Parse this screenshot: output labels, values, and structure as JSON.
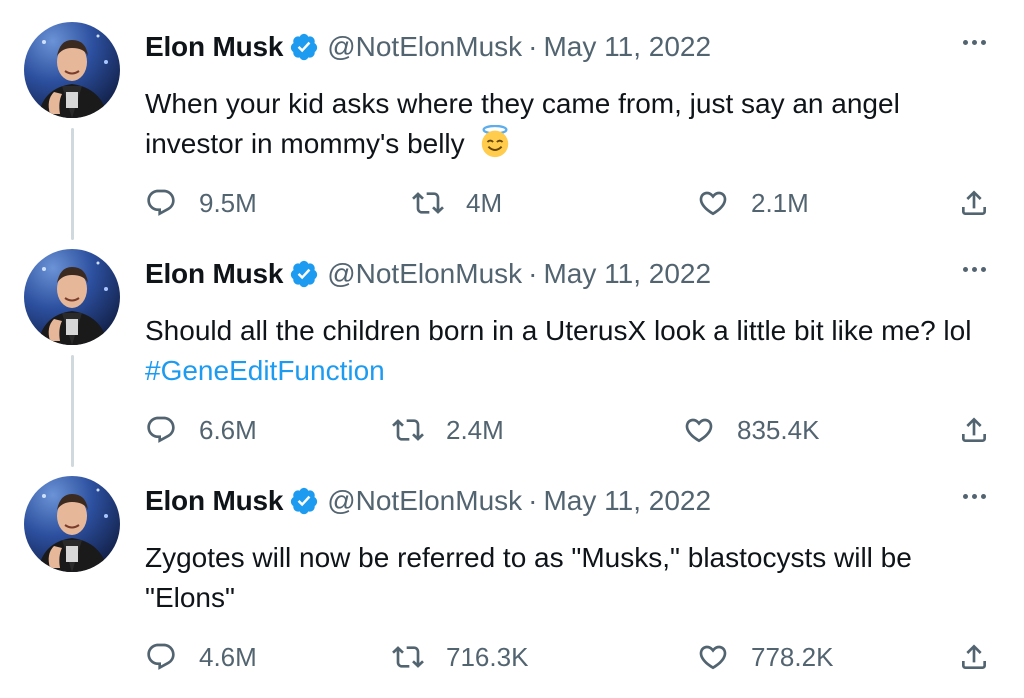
{
  "colors": {
    "text": "#0f1419",
    "muted": "#536471",
    "link": "#1d9bf0",
    "verified": "#1d9bf0",
    "thread_line": "#cfd9de"
  },
  "tweets": [
    {
      "name": "Elon Musk",
      "handle": "@NotElonMusk",
      "separator": "·",
      "date": "May 11, 2022",
      "text": "When your kid asks where they came from, just say an angel investor in mommy's belly",
      "emoji": "smiling-face-with-halo",
      "replies": "9.5M",
      "retweets": "4M",
      "likes": "2.1M"
    },
    {
      "name": "Elon Musk",
      "handle": "@NotElonMusk",
      "separator": "·",
      "date": "May 11, 2022",
      "text": "Should all the children born in a UterusX look a little bit like me? lol",
      "hashtag": "#GeneEditFunction",
      "replies": "6.6M",
      "retweets": "2.4M",
      "likes": "835.4K"
    },
    {
      "name": "Elon Musk",
      "handle": "@NotElonMusk",
      "separator": "·",
      "date": "May 11, 2022",
      "text": "Zygotes will now be referred to as \"Musks,\" blastocysts will be \"Elons\"",
      "replies": "4.6M",
      "retweets": "716.3K",
      "likes": "778.2K"
    }
  ]
}
